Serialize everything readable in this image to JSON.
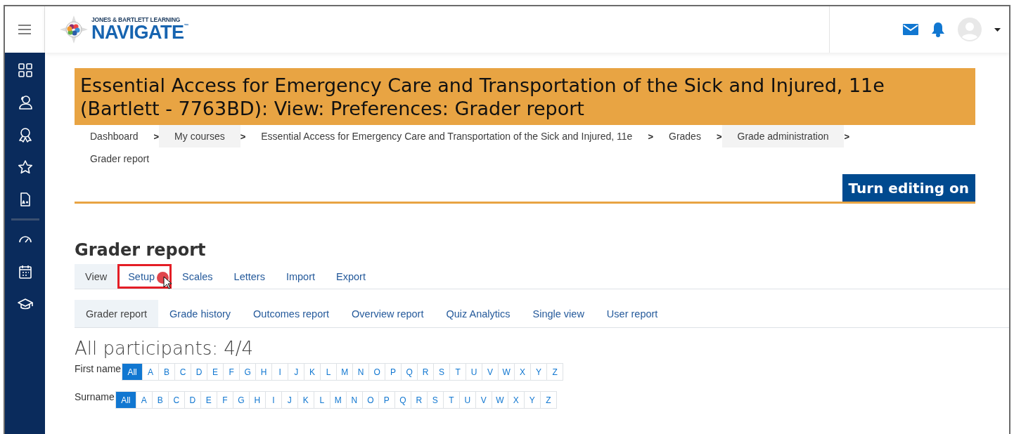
{
  "header": {
    "logo_small": "JONES & BARTLETT LEARNING",
    "logo_big": "NAVIGATE",
    "logo_tm": "™"
  },
  "sidebar": {
    "items": [
      {
        "kind": "grid"
      },
      {
        "kind": "users"
      },
      {
        "kind": "award"
      },
      {
        "kind": "star"
      },
      {
        "kind": "document"
      },
      {
        "kind": "divider"
      },
      {
        "kind": "gauge"
      },
      {
        "kind": "calendar"
      },
      {
        "kind": "cap"
      }
    ]
  },
  "page_title": "Essential Access for Emergency Care and Transportation of the Sick and Injured, 11e (Bartlett - 7763BD): View: Preferences: Grader report",
  "breadcrumbs": [
    {
      "label": "Dashboard",
      "highlighted": false
    },
    {
      "label": "My courses",
      "highlighted": true
    },
    {
      "label": "Essential Access for Emergency Care and Transportation of the Sick and Injured, 11e",
      "highlighted": false
    },
    {
      "label": "Grades",
      "highlighted": false
    },
    {
      "label": "Grade administration",
      "highlighted": true
    },
    {
      "label": "Grader report",
      "highlighted": false
    }
  ],
  "breadcrumb_separator": ">",
  "edit_button": "Turn editing on",
  "heading": "Grader report",
  "tabs": [
    {
      "label": "View",
      "selected": true,
      "annotated": false
    },
    {
      "label": "Setup",
      "selected": false,
      "annotated": true
    },
    {
      "label": "Scales",
      "selected": false,
      "annotated": false
    },
    {
      "label": "Letters",
      "selected": false,
      "annotated": false
    },
    {
      "label": "Import",
      "selected": false,
      "annotated": false
    },
    {
      "label": "Export",
      "selected": false,
      "annotated": false
    }
  ],
  "subtabs": [
    {
      "label": "Grader report",
      "selected": true
    },
    {
      "label": "Grade history",
      "selected": false
    },
    {
      "label": "Outcomes report",
      "selected": false
    },
    {
      "label": "Overview report",
      "selected": false
    },
    {
      "label": "Quiz Analytics",
      "selected": false
    },
    {
      "label": "Single view",
      "selected": false
    },
    {
      "label": "User report",
      "selected": false
    }
  ],
  "participants": "All participants: 4/4",
  "filters": [
    {
      "label": "First name",
      "letters": [
        {
          "label": "All",
          "selected": true
        },
        {
          "label": "A",
          "selected": false
        },
        {
          "label": "B",
          "selected": false
        },
        {
          "label": "C",
          "selected": false
        },
        {
          "label": "D",
          "selected": false
        },
        {
          "label": "E",
          "selected": false
        },
        {
          "label": "F",
          "selected": false
        },
        {
          "label": "G",
          "selected": false
        },
        {
          "label": "H",
          "selected": false
        },
        {
          "label": "I",
          "selected": false
        },
        {
          "label": "J",
          "selected": false
        },
        {
          "label": "K",
          "selected": false
        },
        {
          "label": "L",
          "selected": false
        },
        {
          "label": "M",
          "selected": false
        },
        {
          "label": "N",
          "selected": false
        },
        {
          "label": "O",
          "selected": false
        },
        {
          "label": "P",
          "selected": false
        },
        {
          "label": "Q",
          "selected": false
        },
        {
          "label": "R",
          "selected": false
        },
        {
          "label": "S",
          "selected": false
        },
        {
          "label": "T",
          "selected": false
        },
        {
          "label": "U",
          "selected": false
        },
        {
          "label": "V",
          "selected": false
        },
        {
          "label": "W",
          "selected": false
        },
        {
          "label": "X",
          "selected": false
        },
        {
          "label": "Y",
          "selected": false
        },
        {
          "label": "Z",
          "selected": false
        }
      ]
    },
    {
      "label": "Surname",
      "letters": [
        {
          "label": "All",
          "selected": true
        },
        {
          "label": "A",
          "selected": false
        },
        {
          "label": "B",
          "selected": false
        },
        {
          "label": "C",
          "selected": false
        },
        {
          "label": "D",
          "selected": false
        },
        {
          "label": "E",
          "selected": false
        },
        {
          "label": "F",
          "selected": false
        },
        {
          "label": "G",
          "selected": false
        },
        {
          "label": "H",
          "selected": false
        },
        {
          "label": "I",
          "selected": false
        },
        {
          "label": "J",
          "selected": false
        },
        {
          "label": "K",
          "selected": false
        },
        {
          "label": "L",
          "selected": false
        },
        {
          "label": "M",
          "selected": false
        },
        {
          "label": "N",
          "selected": false
        },
        {
          "label": "O",
          "selected": false
        },
        {
          "label": "P",
          "selected": false
        },
        {
          "label": "Q",
          "selected": false
        },
        {
          "label": "R",
          "selected": false
        },
        {
          "label": "S",
          "selected": false
        },
        {
          "label": "T",
          "selected": false
        },
        {
          "label": "U",
          "selected": false
        },
        {
          "label": "V",
          "selected": false
        },
        {
          "label": "W",
          "selected": false
        },
        {
          "label": "X",
          "selected": false
        },
        {
          "label": "Y",
          "selected": false
        },
        {
          "label": "Z",
          "selected": false
        }
      ]
    }
  ]
}
